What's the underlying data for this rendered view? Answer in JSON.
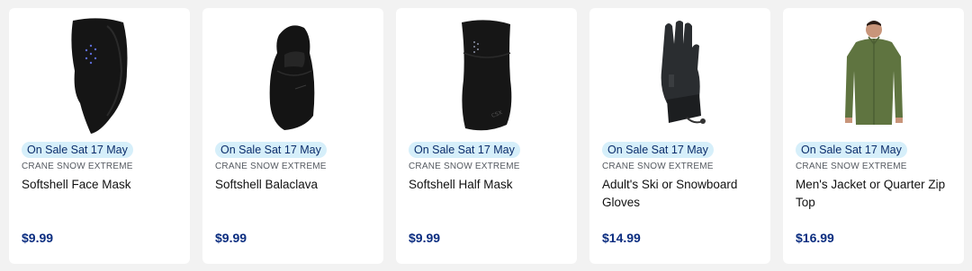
{
  "products": [
    {
      "badge": "On Sale Sat 17 May",
      "brand": "CRANE SNOW EXTREME",
      "title": "Softshell Face Mask",
      "price": "$9.99",
      "image_icon": "face-mask-image"
    },
    {
      "badge": "On Sale Sat 17 May",
      "brand": "CRANE SNOW EXTREME",
      "title": "Softshell Balaclava",
      "price": "$9.99",
      "image_icon": "balaclava-image"
    },
    {
      "badge": "On Sale Sat 17 May",
      "brand": "CRANE SNOW EXTREME",
      "title": "Softshell Half Mask",
      "price": "$9.99",
      "image_icon": "half-mask-image"
    },
    {
      "badge": "On Sale Sat 17 May",
      "brand": "CRANE SNOW EXTREME",
      "title": "Adult's Ski or Snowboard Gloves",
      "price": "$14.99",
      "image_icon": "gloves-image"
    },
    {
      "badge": "On Sale Sat 17 May",
      "brand": "CRANE SNOW EXTREME",
      "title": "Men's Jacket or Quarter Zip Top",
      "price": "$16.99",
      "image_icon": "jacket-image"
    }
  ],
  "colors": {
    "badge_bg": "#d6effa",
    "badge_text": "#0b2d6b",
    "price": "#0b2d80",
    "jacket": "#5f7440"
  }
}
